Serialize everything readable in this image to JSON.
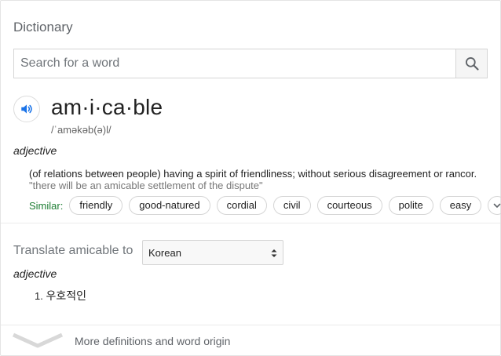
{
  "card": {
    "title": "Dictionary"
  },
  "search": {
    "placeholder": "Search for a word",
    "value": ""
  },
  "entry": {
    "headword": "am·i·ca·ble",
    "phonetic": "/ˈaməkəb(ə)l/",
    "part_of_speech": "adjective",
    "definition": "(of relations between people) having a spirit of friendliness; without serious disagreement or rancor.",
    "example": "\"there will be an amicable settlement of the dispute\"",
    "similar_label": "Similar:",
    "similar_words": [
      "friendly",
      "good-natured",
      "cordial",
      "civil",
      "courteous",
      "polite",
      "easy"
    ]
  },
  "translate": {
    "label": "Translate amicable to",
    "selected_language": "Korean",
    "part_of_speech": "adjective",
    "items": [
      {
        "number": "1.",
        "text": "우호적인"
      }
    ]
  },
  "footer": {
    "more_label": "More definitions and word origin"
  },
  "icons": {
    "search": "search-icon",
    "speaker": "speaker-icon",
    "expand": "chevron-down-icon",
    "select": "select-arrows-icon",
    "footer": "chevron-down-icon"
  },
  "colors": {
    "accent_blue": "#1a73e8",
    "similar_green": "#1e7e34",
    "muted_text": "#70757a"
  }
}
